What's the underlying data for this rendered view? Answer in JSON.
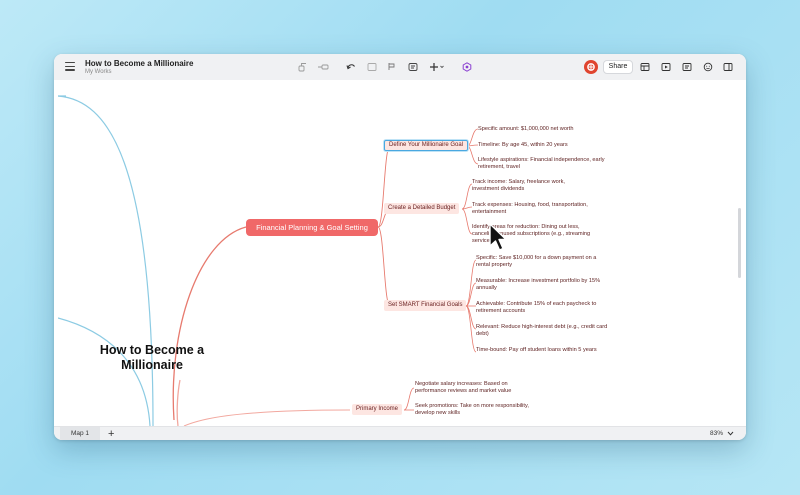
{
  "document": {
    "title": "How to Become a Millionaire",
    "subtitle": "My Works"
  },
  "toolbar": {
    "icons": [
      "topic-icon",
      "subtopic-icon",
      "undo-icon",
      "boundary-icon",
      "callout-icon",
      "note-icon",
      "insert-icon",
      "ai-icon"
    ],
    "share_label": "Share",
    "right_icons": [
      "outliner-icon",
      "pitch-icon",
      "comment-icon",
      "sticker-icon",
      "format-panel-icon"
    ]
  },
  "colors": {
    "main_topic": "#f06868",
    "subtopic_bg": "#fde6e2",
    "branch_red": "#e77a6e",
    "branch_blue": "#8ccbe3",
    "selection": "#4aa8e0"
  },
  "mindmap": {
    "central": "How to Become a Millionaire",
    "main_topic": "Financial Planning & Goal Setting",
    "subtopics": [
      {
        "label": "Define Your Millionaire Goal",
        "leaves": [
          "Specific amount: $1,000,000 net worth",
          "Timeline: By age 45, within 20 years",
          "Lifestyle aspirations: Financial independence, early retirement, travel"
        ]
      },
      {
        "label": "Create a Detailed Budget",
        "leaves": [
          "Track income: Salary, freelance work, investment dividends",
          "Track expenses: Housing, food, transportation, entertainment",
          "Identify areas for reduction: Dining out less, canceling unused subscriptions (e.g., streaming services)"
        ]
      },
      {
        "label": "Set SMART Financial Goals",
        "leaves": [
          "Specific: Save $10,000 for a down payment on a rental property",
          "Measurable: Increase investment portfolio by 15% annually",
          "Achievable: Contribute 15% of each paycheck to retirement accounts",
          "Relevant: Reduce high-interest debt (e.g., credit card debt)",
          "Time-bound: Pay off student loans within 5 years"
        ]
      }
    ],
    "second_topic": {
      "label": "Primary Income",
      "leaves": [
        "Negotiate salary increases: Based on performance reviews and market value",
        "Seek promotions: Take on more responsibility, develop new skills"
      ]
    }
  },
  "bottom": {
    "tab": "Map 1",
    "add": "+",
    "zoom": "83%"
  }
}
